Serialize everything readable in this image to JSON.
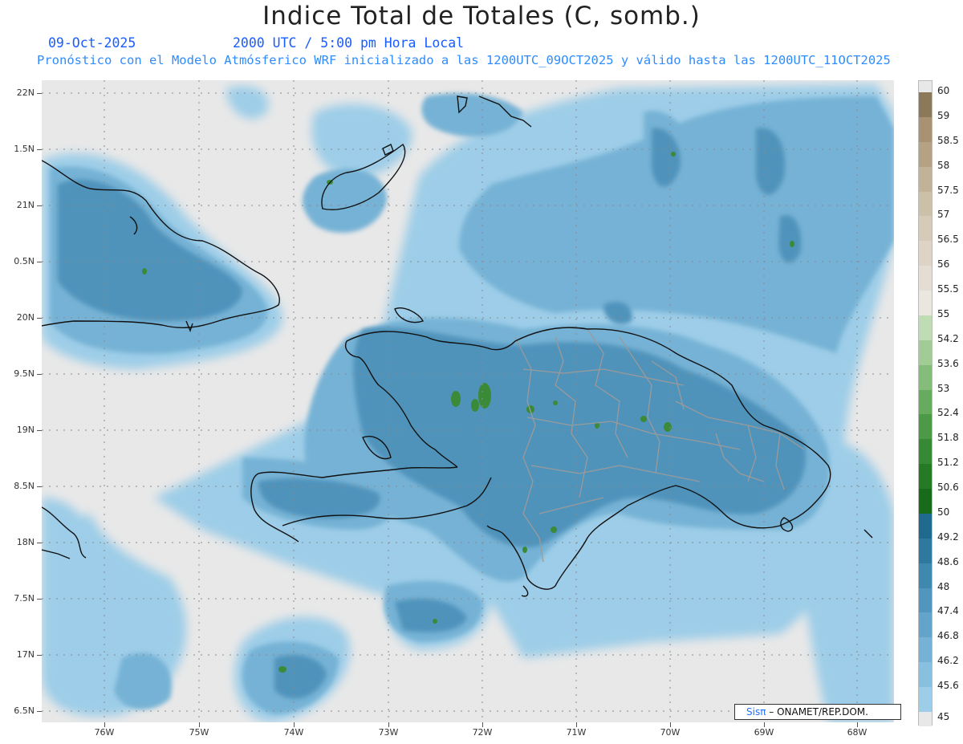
{
  "header": {
    "title": "Indice Total de Totales (C, somb.)",
    "date": "09-Oct-2025",
    "time": "2000 UTC / 5:00 pm Hora Local",
    "forecast_line": "Pronóstico con el Modelo Atmósferico WRF inicializado a las 1200UTC_09OCT2025 y válido hasta las  1200UTC_11OCT2025"
  },
  "map": {
    "lat_labels": [
      "22N",
      "1.5N",
      "21N",
      "0.5N",
      "20N",
      "9.5N",
      "19N",
      "8.5N",
      "18N",
      "7.5N",
      "17N",
      "6.5N"
    ],
    "lon_labels": [
      "76W",
      "75W",
      "74W",
      "73W",
      "72W",
      "71W",
      "70W",
      "69W",
      "68W"
    ],
    "background_color": "#e8e8e8"
  },
  "legend": {
    "levels": [
      "60",
      "59",
      "58.5",
      "58",
      "57.5",
      "57",
      "56.5",
      "56",
      "55.5",
      "55",
      "54.2",
      "53.6",
      "53",
      "52.4",
      "51.8",
      "51.2",
      "50.6",
      "50",
      "49.2",
      "48.6",
      "48",
      "47.4",
      "46.8",
      "46.2",
      "45.6",
      "45"
    ],
    "colors": [
      "#8b7a5a",
      "#a89272",
      "#b5a284",
      "#c2b297",
      "#cdc0a9",
      "#d6cbb8",
      "#ddd4c6",
      "#e4ddd3",
      "#ebe7e0",
      "#c0dcb4",
      "#a2cc96",
      "#84bc7a",
      "#67ab5f",
      "#4c9a47",
      "#378a35",
      "#257a26",
      "#176b1a",
      "#206a8f",
      "#2f78a0",
      "#3f88b0",
      "#5196be",
      "#63a4ca",
      "#76b2d5",
      "#88c0df",
      "#9dcde8"
    ]
  },
  "credit": {
    "brand": "Sisπ",
    "text": " – ONAMET/REP.DOM."
  }
}
